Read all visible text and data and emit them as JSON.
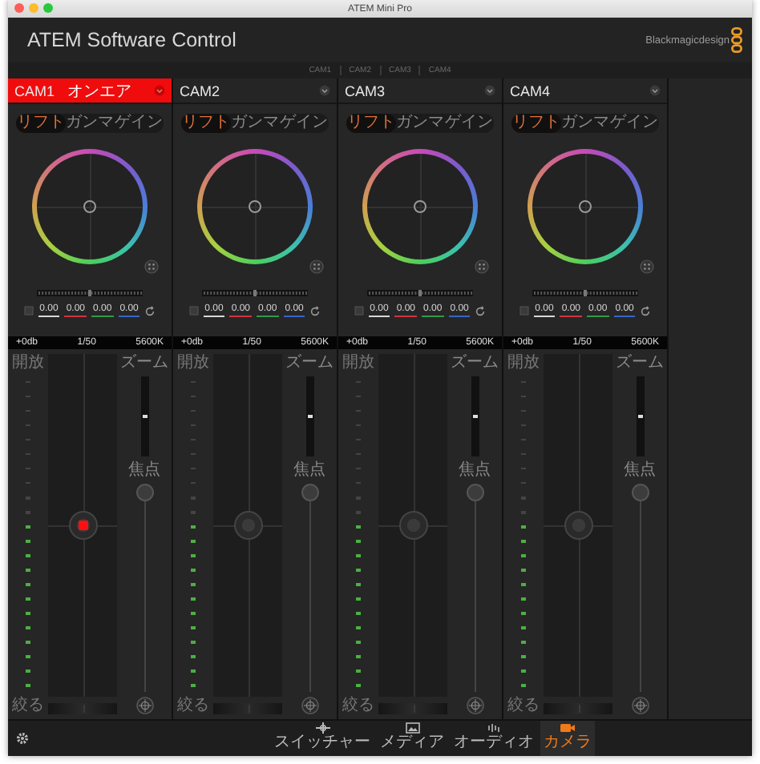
{
  "window": {
    "title": "ATEM Mini Pro"
  },
  "header": {
    "app_title": "ATEM Software Control",
    "logo_text": "Blackmagicdesign"
  },
  "camera_tabs": [
    "CAM1",
    "CAM2",
    "CAM3",
    "CAM4"
  ],
  "cameras": [
    {
      "name": "CAM1",
      "on_air": true,
      "on_air_label": "オンエア",
      "tabs": [
        {
          "label": "リフト",
          "selected": true
        },
        {
          "label": "ガンマ",
          "selected": false
        },
        {
          "label": "ゲイン",
          "selected": false
        }
      ],
      "values": [
        {
          "text": "0.00",
          "color": "#d8d8d8"
        },
        {
          "text": "0.00",
          "color": "#d0343c"
        },
        {
          "text": "0.00",
          "color": "#2f9a4a"
        },
        {
          "text": "0.00",
          "color": "#3566c8"
        }
      ],
      "gain": "+0db",
      "shutter": "1/50",
      "white_balance": "5600K",
      "iris_open_label": "開放",
      "iris_close_label": "絞る",
      "zoom_label": "ズーム",
      "focus_label": "焦点",
      "iris": {
        "level": 0.55
      },
      "luminance": {
        "level": 0.5
      },
      "pedestal": {
        "level": 0.5
      },
      "zoom": {
        "level": 0.5
      },
      "focus": {
        "level": 1
      }
    },
    {
      "name": "CAM2",
      "on_air": false,
      "tabs": [
        {
          "label": "リフト",
          "selected": true
        },
        {
          "label": "ガンマ",
          "selected": false
        },
        {
          "label": "ゲイン",
          "selected": false
        }
      ],
      "values": [
        {
          "text": "0.00",
          "color": "#d8d8d8"
        },
        {
          "text": "0.00",
          "color": "#d0343c"
        },
        {
          "text": "0.00",
          "color": "#2f9a4a"
        },
        {
          "text": "0.00",
          "color": "#3566c8"
        }
      ],
      "gain": "+0db",
      "shutter": "1/50",
      "white_balance": "5600K",
      "iris_open_label": "開放",
      "iris_close_label": "絞る",
      "zoom_label": "ズーム",
      "focus_label": "焦点",
      "iris": {
        "level": 0.55
      },
      "luminance": {
        "level": 0.5
      },
      "pedestal": {
        "level": 0.5
      },
      "zoom": {
        "level": 0.5
      },
      "focus": {
        "level": 1
      }
    },
    {
      "name": "CAM3",
      "on_air": false,
      "tabs": [
        {
          "label": "リフト",
          "selected": true
        },
        {
          "label": "ガンマ",
          "selected": false
        },
        {
          "label": "ゲイン",
          "selected": false
        }
      ],
      "values": [
        {
          "text": "0.00",
          "color": "#d8d8d8"
        },
        {
          "text": "0.00",
          "color": "#d0343c"
        },
        {
          "text": "0.00",
          "color": "#2f9a4a"
        },
        {
          "text": "0.00",
          "color": "#3566c8"
        }
      ],
      "gain": "+0db",
      "shutter": "1/50",
      "white_balance": "5600K",
      "iris_open_label": "開放",
      "iris_close_label": "絞る",
      "zoom_label": "ズーム",
      "focus_label": "焦点",
      "iris": {
        "level": 0.55
      },
      "luminance": {
        "level": 0.5
      },
      "pedestal": {
        "level": 0.5
      },
      "zoom": {
        "level": 0.5
      },
      "focus": {
        "level": 1
      }
    },
    {
      "name": "CAM4",
      "on_air": false,
      "tabs": [
        {
          "label": "リフト",
          "selected": true
        },
        {
          "label": "ガンマ",
          "selected": false
        },
        {
          "label": "ゲイン",
          "selected": false
        }
      ],
      "values": [
        {
          "text": "0.00",
          "color": "#d8d8d8"
        },
        {
          "text": "0.00",
          "color": "#d0343c"
        },
        {
          "text": "0.00",
          "color": "#2f9a4a"
        },
        {
          "text": "0.00",
          "color": "#3566c8"
        }
      ],
      "gain": "+0db",
      "shutter": "1/50",
      "white_balance": "5600K",
      "iris_open_label": "開放",
      "iris_close_label": "絞る",
      "zoom_label": "ズーム",
      "focus_label": "焦点",
      "iris": {
        "level": 0.55
      },
      "luminance": {
        "level": 0.5
      },
      "pedestal": {
        "level": 0.5
      },
      "zoom": {
        "level": 0.5
      },
      "focus": {
        "level": 1
      }
    }
  ],
  "bottom_nav": [
    {
      "kind": "switcher",
      "label": "スイッチャー",
      "selected": false
    },
    {
      "kind": "media",
      "label": "メディア",
      "selected": false
    },
    {
      "kind": "audio",
      "label": "オーディオ",
      "selected": false
    },
    {
      "kind": "camera",
      "label": "カメラ",
      "selected": true
    }
  ]
}
